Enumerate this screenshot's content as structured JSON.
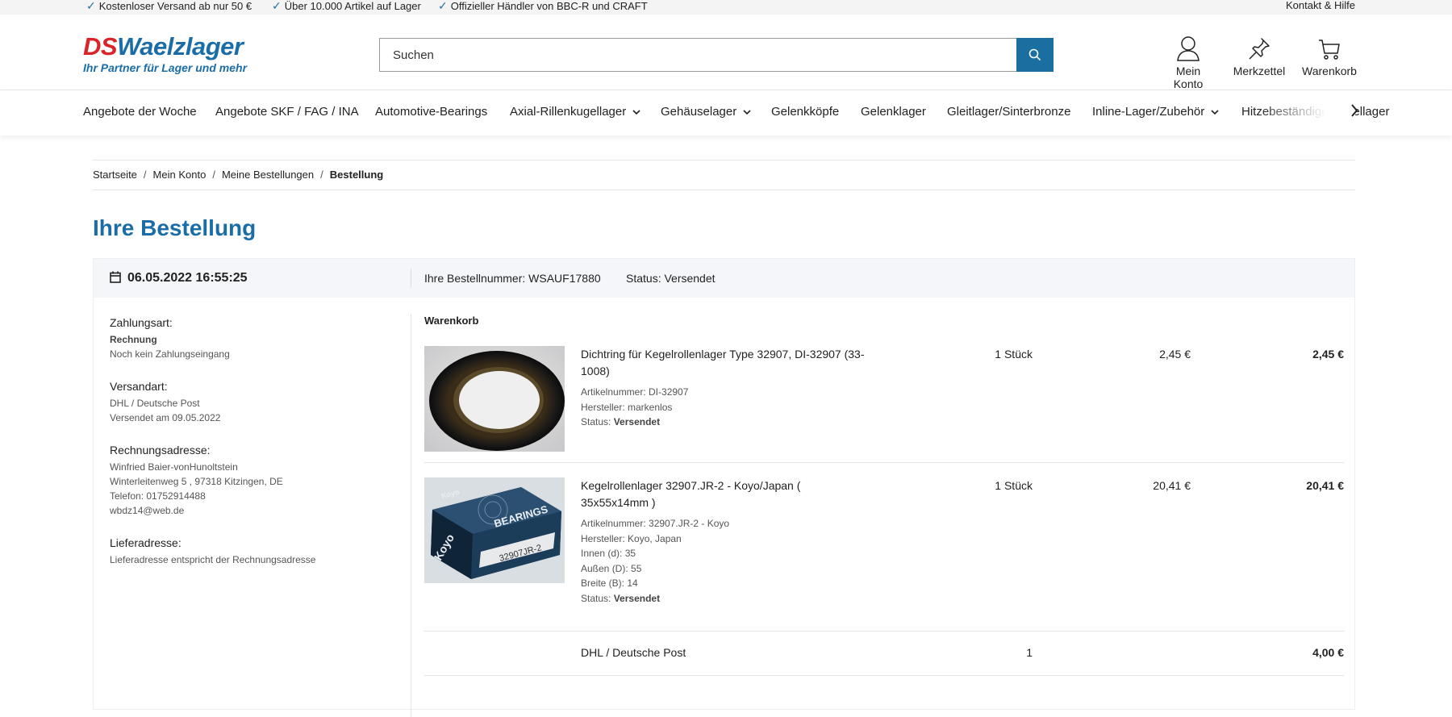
{
  "topbar": {
    "usps": [
      "Kostenloser Versand ab nur 50 €",
      "Über 10.000 Artikel auf Lager",
      "Offizieller Händler von BBC-R und CRAFT"
    ],
    "help": "Kontakt & Hilfe"
  },
  "header": {
    "logo_ds": "DS",
    "logo_name": "Waelzlager",
    "slogan": "Ihr Partner für Lager und mehr",
    "search_placeholder": "Suchen",
    "account": "Mein Konto",
    "wishlist": "Merkzettel",
    "cart": "Warenkorb"
  },
  "nav": {
    "items": [
      "Angebote der Woche",
      "Angebote SKF / FAG / INA",
      "Automotive-Bearings",
      "Axial-Rillenkugellager",
      "Gehäuselager",
      "Gelenkköpfe",
      "Gelenklager",
      "Gleitlager/Sinterbronze",
      "Inline-Lager/Zubehör",
      "Hitzebeständige Kugellager"
    ]
  },
  "breadcrumb": [
    "Startseite",
    "Mein Konto",
    "Meine Bestellungen",
    "Bestellung"
  ],
  "page_title": "Ihre Bestellung",
  "order": {
    "date": "06.05.2022 16:55:25",
    "number": "Ihre Bestellnummer: WSAUF17880",
    "status": "Status: Versendet",
    "payment": {
      "heading": "Zahlungsart:",
      "method": "Rechnung",
      "note": "Noch kein Zahlungseingang"
    },
    "shipping": {
      "heading": "Versandart:",
      "method": "DHL / Deutsche Post",
      "note": "Versendet am 09.05.2022"
    },
    "billing": {
      "heading": "Rechnungsadresse:",
      "lines": [
        "Winfried Baier-vonHunoltstein",
        "Winterleitenweg 5 , 97318 Kitzingen, DE",
        "Telefon: 01752914488",
        "wbdz14@web.de"
      ]
    },
    "delivery": {
      "heading": "Lieferadresse:",
      "note": "Lieferadresse entspricht der Rechnungsadresse"
    },
    "cart_title": "Warenkorb",
    "status_label": "Status:",
    "status_value": "Versendet",
    "items": [
      {
        "name": "Dichtring für Kegelrollenlager Type 32907, DI-32907 (33-1008)",
        "meta": [
          "Artikelnummer: DI-32907",
          "Hersteller: markenlos"
        ],
        "qty": "1 Stück",
        "price": "2,45 €",
        "total": "2,45 €"
      },
      {
        "name": "Kegelrollenlager 32907.JR-2 - Koyo/Japan ( 35x55x14mm )",
        "meta": [
          "Artikelnummer: 32907.JR-2 - Koyo",
          "Hersteller: Koyo, Japan",
          "Innen (d): 35",
          "Außen (D): 55",
          "Breite (B): 14"
        ],
        "qty": "1 Stück",
        "price": "20,41 €",
        "total": "20,41 €",
        "box_brand": "Koyo",
        "box_label": "BEARINGS",
        "box_code": "32907JR-2"
      }
    ],
    "shipping_line": {
      "name": "DHL / Deutsche Post",
      "qty": "1",
      "total": "4,00 €"
    }
  },
  "colors": {
    "accent": "#1b6da8",
    "brand_red": "#d9252a",
    "search_button": "#1a6fa0"
  }
}
